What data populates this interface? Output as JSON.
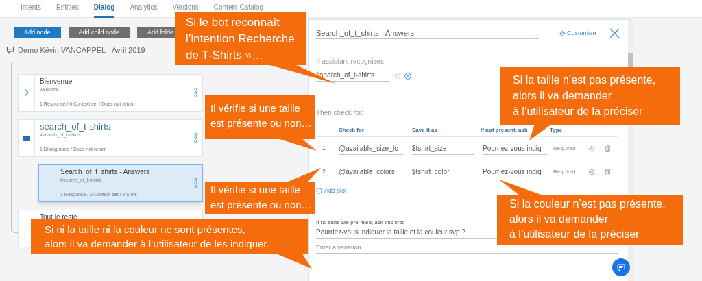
{
  "tabs": [
    {
      "label": "Intents",
      "selected": false
    },
    {
      "label": "Entities",
      "selected": false
    },
    {
      "label": "Dialog",
      "selected": true
    },
    {
      "label": "Analytics",
      "selected": false
    },
    {
      "label": "Versions",
      "selected": false
    },
    {
      "label": "Content Catalog",
      "selected": false
    }
  ],
  "toolbar": [
    {
      "label": "Add node",
      "kind": "primary"
    },
    {
      "label": "Add child node",
      "kind": "secondary"
    },
    {
      "label": "Add folde",
      "kind": "secondary"
    }
  ],
  "dialog_title": "Demo Kévin VANCAPPEL - Avril 2019",
  "nodes": [
    {
      "kind": "chevron",
      "title": "Bienvenue",
      "condition": "welcome",
      "summary": "1 Response / 0 Context set / Does not return",
      "selected": false
    },
    {
      "kind": "folder",
      "title": "search_of_t-shirts",
      "condition": "#search_of_t-shirts",
      "summary": "1 Dialog node / Does not return",
      "selected": false,
      "children": [
        {
          "kind": "plain",
          "title": "Search_of_t_shirts - Answers",
          "condition": "#search_of_t-shirts",
          "summary": "1 Response / 2 Context set / 2 Slots",
          "selected": true
        }
      ]
    },
    {
      "kind": "plain",
      "title": "Tout le reste",
      "selected": false
    }
  ],
  "editor": {
    "title": "Search_of_t_shirts - Answers",
    "customize": "Customize",
    "condition_label": "If assistant recognizes:",
    "condition_value": "#search_of_t-shirts",
    "then_label": "Then check for:",
    "columns": [
      "Check for",
      "Save it as",
      "If not present, ask",
      "Type"
    ],
    "slots": [
      {
        "number": "1",
        "check_for": "@available_size_fc",
        "save_as": "$tshirt_size",
        "prompt": "Pourriez-vous indiq",
        "type": "Required"
      },
      {
        "number": "2",
        "check_for": "@available_colors_",
        "save_as": "$tshirt_color",
        "prompt": "Pourriez-vous indiq",
        "type": "Required"
      }
    ],
    "add_slot": "Add slot",
    "prefill_label": "If no slots are pre-filled, ask this first:",
    "prefill_value": "Pourriez-vous indiquer la taille et la couleur svp ?",
    "variation_placeholder": "Enter a variation"
  },
  "callouts": [
    {
      "lines": [
        "Si le bot reconnaît",
        "l’intention Recherche",
        "de T-Shirts »…"
      ]
    },
    {
      "lines": [
        "Il vérifie si une taille",
        "est présente ou non…"
      ]
    },
    {
      "lines": [
        "Il vérifie si une taille",
        "est présente ou non…"
      ]
    },
    {
      "lines": [
        "Si ni la taille ni la couleur ne sont présentes,",
        "alors il va demander à l’utilisateur de les indiquer."
      ]
    },
    {
      "lines": [
        "Si la taille n’est pas présente,",
        "alors il va demander",
        "à l’utilisateur de la préciser"
      ]
    },
    {
      "lines": [
        "Si la couleur n’est pas présente,",
        "alors il va demander",
        "à l’utilisateur de la préciser"
      ]
    }
  ]
}
